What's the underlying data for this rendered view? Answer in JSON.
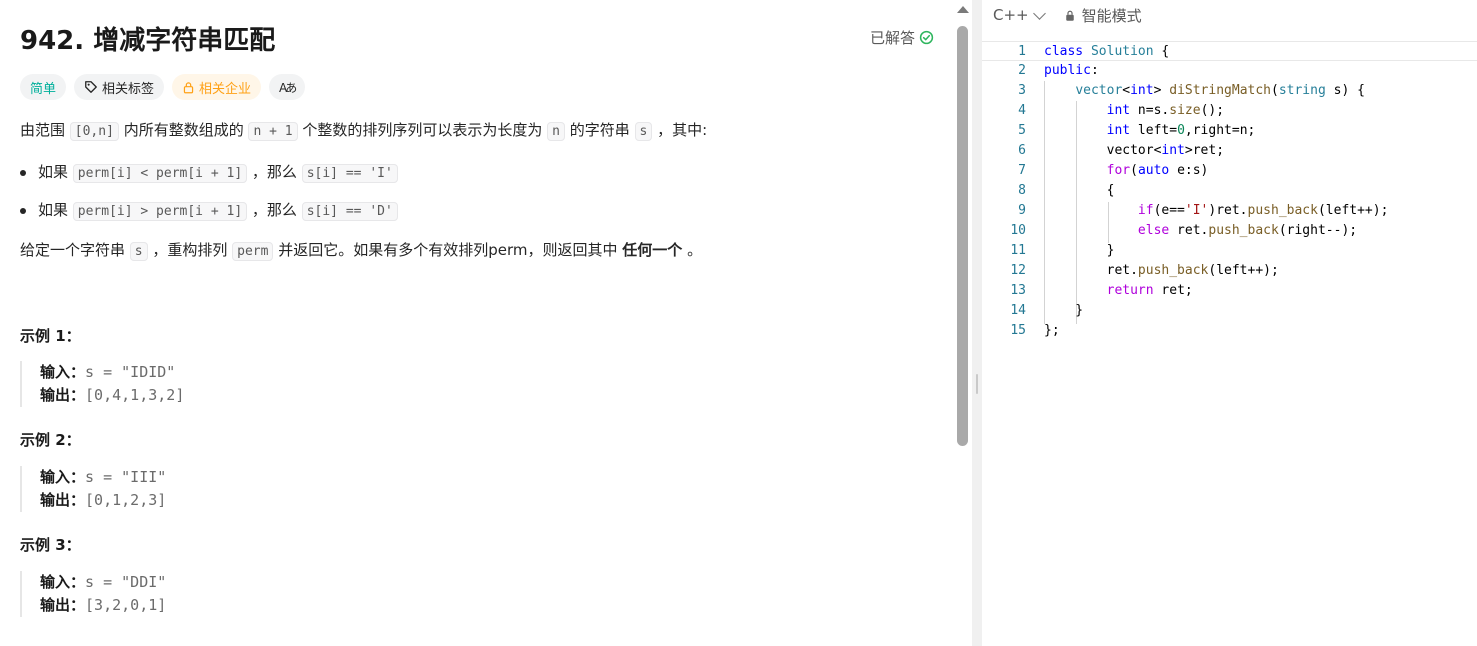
{
  "problem": {
    "title": "942. 增减字符串匹配",
    "status": "已解答",
    "tags": {
      "difficulty": "简单",
      "related_tags": "相关标签",
      "related_companies": "相关企业",
      "translate": "Aあ"
    },
    "desc": {
      "p1_a": "由范围 ",
      "p1_code1": "[0,n]",
      "p1_b": " 内所有整数组成的 ",
      "p1_code2": "n + 1",
      "p1_c": " 个整数的排列序列可以表示为长度为 ",
      "p1_code3": "n",
      "p1_d": " 的字符串 ",
      "p1_code4": "s",
      "p1_e": " ，其中:",
      "b1_a": "如果 ",
      "b1_code1": "perm[i] < perm[i + 1]",
      "b1_b": " ，那么 ",
      "b1_code2": "s[i] == 'I'",
      "b2_a": "如果 ",
      "b2_code1": "perm[i] > perm[i + 1]",
      "b2_b": " ，那么 ",
      "b2_code2": "s[i] == 'D'",
      "p2_a": "给定一个字符串 ",
      "p2_code1": "s",
      "p2_b": " ，重构排列 ",
      "p2_code2": "perm",
      "p2_c": " 并返回它。如果有多个有效排列perm，则返回其中 ",
      "p2_bold": "任何一个",
      "p2_d": " 。"
    },
    "examples": [
      {
        "title": "示例 1：",
        "input_label": "输入：",
        "input": "s = \"IDID\"",
        "output_label": "输出：",
        "output": "[0,4,1,3,2]"
      },
      {
        "title": "示例 2：",
        "input_label": "输入：",
        "input": "s = \"III\"",
        "output_label": "输出：",
        "output": "[0,1,2,3]"
      },
      {
        "title": "示例 3：",
        "input_label": "输入：",
        "input": "s = \"DDI\"",
        "output_label": "输出：",
        "output": "[3,2,0,1]"
      }
    ]
  },
  "editor": {
    "language": "C++",
    "mode": "智能模式",
    "line_numbers": [
      "1",
      "2",
      "3",
      "4",
      "5",
      "6",
      "7",
      "8",
      "9",
      "10",
      "11",
      "12",
      "13",
      "14",
      "15"
    ]
  },
  "colors": {
    "easy": "#00af9b",
    "company": "#ffa116",
    "solved_check": "#2db55d",
    "keyword": "#0000ff",
    "control_keyword": "#af00db",
    "type": "#267f99",
    "function": "#795e26",
    "number": "#098658",
    "string": "#a31515",
    "line_number": "#237893"
  },
  "icons": [
    "check-circle-icon",
    "tag-icon",
    "lock-icon",
    "translate-icon",
    "chevron-down-icon",
    "scroll-up-arrow-icon"
  ]
}
